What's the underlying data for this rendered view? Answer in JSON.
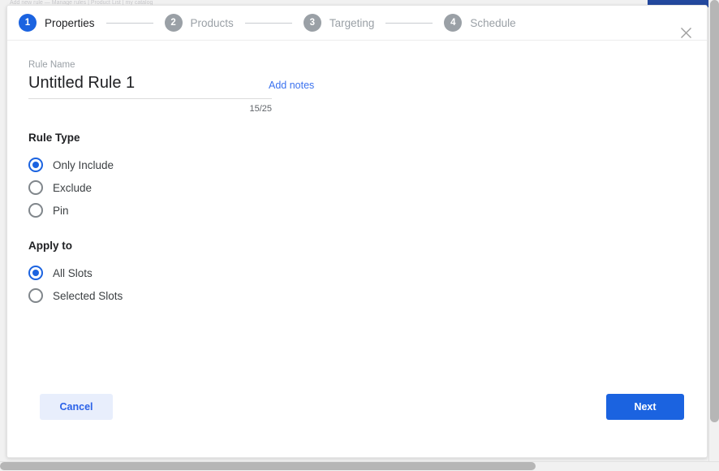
{
  "backdrop": {
    "top_text": "Add new rule — Manage rules | Product List | my catalog"
  },
  "colors": {
    "accent_blue": "#1b63e0",
    "link_blue": "#3b72ef",
    "cancel_bg": "#e8eefc",
    "inactive_gray": "#9aa0a6",
    "text_primary": "#202124"
  },
  "modal": {
    "stepper": {
      "steps": [
        {
          "number": "1",
          "label": "Properties",
          "state": "active"
        },
        {
          "number": "2",
          "label": "Products",
          "state": "inactive"
        },
        {
          "number": "3",
          "label": "Targeting",
          "state": "inactive"
        },
        {
          "number": "4",
          "label": "Schedule",
          "state": "inactive"
        }
      ]
    },
    "close_icon": "✕",
    "form": {
      "rule_name": {
        "label": "Rule Name",
        "value": "Untitled Rule 1",
        "placeholder": "Untitled Rule 1",
        "counter": "15/25",
        "add_notes_label": "Add notes"
      },
      "rule_type": {
        "title": "Rule Type",
        "options": [
          {
            "label": "Only Include",
            "checked": true
          },
          {
            "label": "Exclude",
            "checked": false
          },
          {
            "label": "Pin",
            "checked": false
          }
        ]
      },
      "apply_to": {
        "title": "Apply to",
        "options": [
          {
            "label": "All Slots",
            "checked": true
          },
          {
            "label": "Selected Slots",
            "checked": false
          }
        ]
      }
    },
    "footer": {
      "cancel_label": "Cancel",
      "next_label": "Next"
    }
  }
}
